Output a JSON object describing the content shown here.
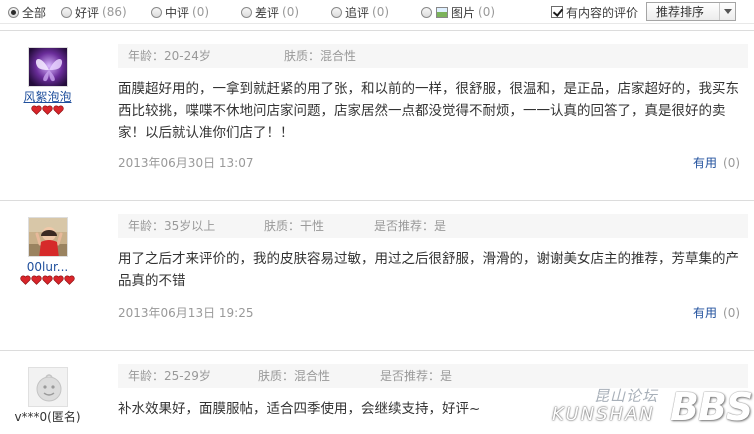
{
  "filters": [
    {
      "label": "全部",
      "count": "",
      "checked": true
    },
    {
      "label": "好评",
      "count": "(86)",
      "checked": false
    },
    {
      "label": "中评",
      "count": "(0)",
      "checked": false
    },
    {
      "label": "差评",
      "count": "(0)",
      "checked": false
    },
    {
      "label": "追评",
      "count": "(0)",
      "checked": false
    },
    {
      "label": "图片",
      "count": "(0)",
      "checked": false
    }
  ],
  "has_content": {
    "label": "有内容的评价",
    "checked": true
  },
  "sort": {
    "selected": "推荐排序"
  },
  "reviews": [
    {
      "user": "风絮泡泡",
      "rank_hearts": 3,
      "age": "年龄：20-24岁",
      "skin": "肤质：混合性",
      "recommend": "",
      "content": "面膜超好用的，一拿到就赶紧的用了张，和以前的一样，很舒服，很温和，是正品，店家超好的，我买东西比较挑，喋喋不休地问店家问题，店家居然一点都没觉得不耐烦，一一认真的回答了，真是很好的卖家！以后就认准你们店了！！",
      "date": "2013年06月30日 13:07",
      "useful_label": "有用",
      "useful_count": "(0)"
    },
    {
      "user": "00lur...",
      "rank_hearts": 5,
      "age": "年龄：35岁以上",
      "skin": "肤质：干性",
      "recommend": "是否推荐：是",
      "content": "用了之后才来评价的，我的皮肤容易过敏，用过之后很舒服，滑滑的，谢谢美女店主的推荐，芳草集的产品真的不错",
      "date": "2013年06月13日 19:25",
      "useful_label": "有用",
      "useful_count": "(0)"
    },
    {
      "user": "v***0(匿名)",
      "rank_hearts": 0,
      "age": "年龄：25-29岁",
      "skin": "肤质：混合性",
      "recommend": "是否推荐：是",
      "content": "补水效果好，面膜服帖，适合四季使用，会继续支持，好评~",
      "date": "",
      "useful_label": "",
      "useful_count": ""
    }
  ],
  "watermark": {
    "cn": "昆山论坛",
    "en": "KUNSHAN",
    "bbs": "BBS"
  },
  "icons": {
    "radio": "radio-icon",
    "image": "image-icon",
    "checkbox": "checkbox-icon",
    "dropdown": "chevron-down-icon",
    "heart": "heart-icon"
  },
  "colors": {
    "link": "#1f4f9c",
    "muted": "#999999",
    "meta_bg": "#f6f6f6",
    "heart": "#d9252a"
  }
}
